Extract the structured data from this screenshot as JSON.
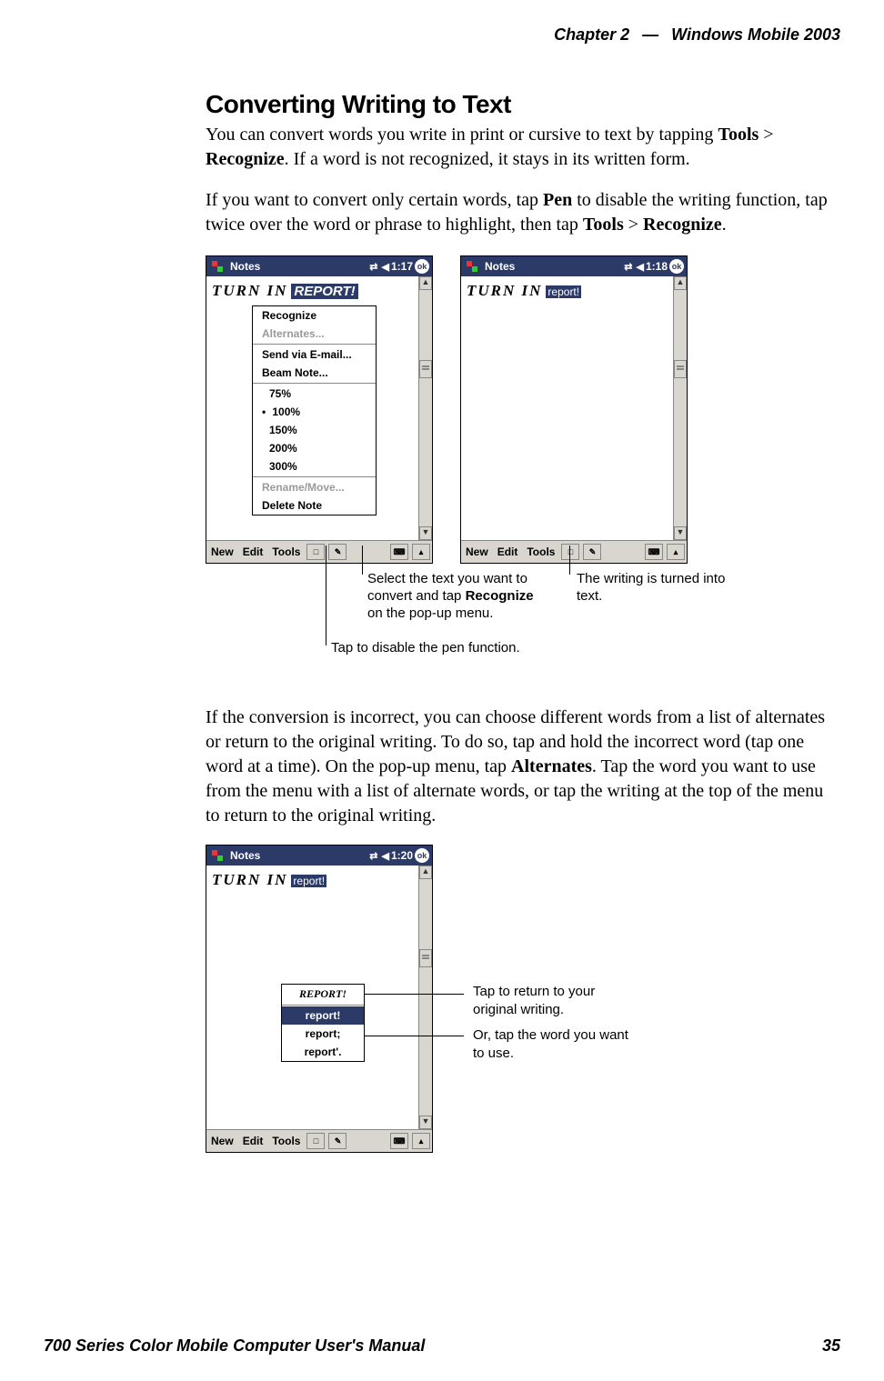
{
  "header": {
    "chapter": "Chapter  2",
    "mdash": "—",
    "product": "Windows Mobile 2003"
  },
  "section_title": "Converting Writing to Text",
  "para1_a": "You can convert words you write in print or cursive to text by tapping ",
  "para1_tools": "Tools",
  "para1_b": " > ",
  "para1_recognize": "Recognize",
  "para1_c": ". If a word is not recognized, it stays in its written form.",
  "para2_a": "If you want to convert only certain words, tap ",
  "para2_pen": "Pen",
  "para2_b": " to disable the writing function, tap twice over the word or phrase to highlight, then tap ",
  "para2_tools": "Tools",
  "para2_c": " > ",
  "para2_recognize": "Recognize",
  "para2_d": ".",
  "device1": {
    "title": "Notes",
    "time": "1:17",
    "ok": "ok",
    "handwriting": "TURN IN",
    "selected": "REPORT!",
    "menu": [
      "Recognize",
      "Alternates...",
      "Send via E-mail...",
      "Beam Note...",
      "75%",
      "100%",
      "150%",
      "200%",
      "300%",
      "Rename/Move...",
      "Delete Note"
    ],
    "footer": [
      "New",
      "Edit",
      "Tools"
    ]
  },
  "device2": {
    "title": "Notes",
    "time": "1:18",
    "ok": "ok",
    "handwriting": "TURN IN",
    "typed": "report!",
    "footer": [
      "New",
      "Edit",
      "Tools"
    ]
  },
  "callout1_a": "Select the text you want to convert and tap ",
  "callout1_b": "Recognize",
  "callout1_c": " on the pop-up menu.",
  "callout2": "The writing is turned into text.",
  "callout3": "Tap to disable the pen function.",
  "para3_a": "If the conversion is incorrect, you can choose different words from a list of alternates or return to the original writing. To do so, tap and hold the incorrect word (tap one word at a time). On the pop-up menu, tap ",
  "para3_alt": "Alternates",
  "para3_b": ". Tap the word you want to use from the menu with a list of alternate words, or tap the writing at the top of the menu to return to the original writing.",
  "device3": {
    "title": "Notes",
    "time": "1:20",
    "ok": "ok",
    "handwriting": "TURN IN",
    "typed": "report!",
    "alts": [
      "REPORT!",
      "report!",
      "report;",
      "report'."
    ],
    "footer": [
      "New",
      "Edit",
      "Tools"
    ]
  },
  "callout4": "Tap to return to your original writing.",
  "callout5": "Or, tap the word you want to use.",
  "footer": {
    "manual": "700 Series Color Mobile Computer User's Manual",
    "page": "35"
  }
}
